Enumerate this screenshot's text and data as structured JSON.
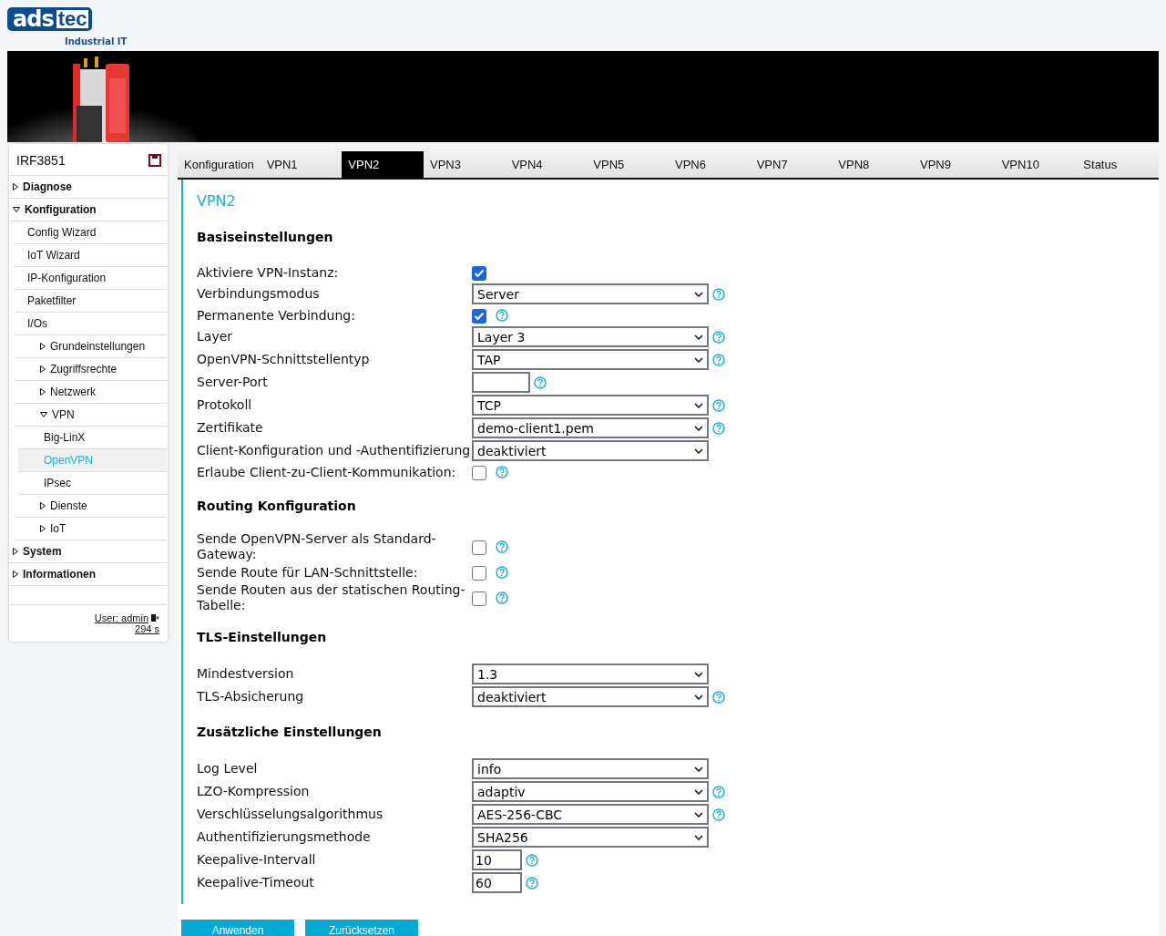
{
  "logo": {
    "part1": "ads",
    "part2": "tec",
    "tagline": "Industrial IT"
  },
  "banner": {
    "kind": "picture"
  },
  "sidebar": {
    "device": "IRF3851",
    "items": [
      {
        "label": "Diagnose",
        "expanded": false,
        "selected": false
      },
      {
        "label": "Konfiguration",
        "expanded": true,
        "selected": false,
        "children": [
          {
            "label": "Config Wizard",
            "selected": false
          },
          {
            "label": "IoT Wizard",
            "selected": false
          },
          {
            "label": "IP-Konfiguration",
            "selected": false
          },
          {
            "label": "Paketfilter",
            "selected": false
          },
          {
            "label": "I/Os",
            "selected": false
          },
          {
            "label": "Grundeinstellungen",
            "expanded": false,
            "selected": false
          },
          {
            "label": "Zugriffsrechte",
            "expanded": false,
            "selected": false
          },
          {
            "label": "Netzwerk",
            "expanded": false,
            "selected": false
          },
          {
            "label": "VPN",
            "expanded": true,
            "selected": false,
            "children": [
              {
                "label": "Big-LinX",
                "selected": false
              },
              {
                "label": "OpenVPN",
                "selected": true
              },
              {
                "label": "IPsec",
                "selected": false
              }
            ]
          },
          {
            "label": "Dienste",
            "expanded": false,
            "selected": false
          },
          {
            "label": "IoT",
            "expanded": false,
            "selected": false
          }
        ]
      },
      {
        "label": "System",
        "expanded": false,
        "selected": false
      },
      {
        "label": "Informationen",
        "expanded": false,
        "selected": false
      }
    ],
    "user": "User: admin",
    "timer": "294 s"
  },
  "tabs": [
    {
      "label": "Konfiguration",
      "selected": false
    },
    {
      "label": "VPN1",
      "selected": false
    },
    {
      "label": "VPN2",
      "selected": true
    },
    {
      "label": "VPN3",
      "selected": false
    },
    {
      "label": "VPN4",
      "selected": false
    },
    {
      "label": "VPN5",
      "selected": false
    },
    {
      "label": "VPN6",
      "selected": false
    },
    {
      "label": "VPN7",
      "selected": false
    },
    {
      "label": "VPN8",
      "selected": false
    },
    {
      "label": "VPN9",
      "selected": false
    },
    {
      "label": "VPN10",
      "selected": false
    },
    {
      "label": "Status",
      "selected": false
    }
  ],
  "title": "VPN2",
  "sections": [
    {
      "heading": "Basiseinstellungen",
      "fields": [
        {
          "kind": "checkbox",
          "label": "Aktiviere VPN-Instanz:",
          "checked": true,
          "help": false
        },
        {
          "kind": "select",
          "label": "Verbindungsmodus",
          "value": "Server",
          "help": true
        },
        {
          "kind": "checkbox",
          "label": "Permanente Verbindung:",
          "checked": true,
          "help": true
        },
        {
          "kind": "select",
          "label": "Layer",
          "value": "Layer 3",
          "help": true
        },
        {
          "kind": "select",
          "label": "OpenVPN-Schnittstellentyp",
          "value": "TAP",
          "help": true
        },
        {
          "kind": "input",
          "label": "Server-Port",
          "help": true
        },
        {
          "kind": "select",
          "label": "Protokoll",
          "value": "TCP",
          "help": true
        },
        {
          "kind": "select",
          "label": "Zertifikate",
          "value": "demo-client1.pem",
          "help": true
        },
        {
          "kind": "select",
          "label": "Client-Konfiguration und -Authentifizierung",
          "value": "deaktiviert",
          "help": false
        },
        {
          "kind": "checkbox",
          "label": "Erlaube Client-zu-Client-Kommunikation:",
          "checked": false,
          "help": true
        }
      ]
    },
    {
      "heading": "Routing Konfiguration",
      "fields": [
        {
          "kind": "checkbox",
          "label": "Sende OpenVPN-Server als Standard-Gateway:",
          "checked": false,
          "help": true
        },
        {
          "kind": "checkbox",
          "label": "Sende Route für LAN-Schnittstelle:",
          "checked": false,
          "help": true
        },
        {
          "kind": "checkbox",
          "label": "Sende Routen aus der statischen Routing-Tabelle:",
          "checked": false,
          "help": true
        }
      ]
    },
    {
      "heading": "TLS-Einstellungen",
      "fields": [
        {
          "kind": "select",
          "label": "Mindestversion",
          "value": "1.3",
          "help": false
        },
        {
          "kind": "select",
          "label": "TLS-Absicherung",
          "value": "deaktiviert",
          "help": true
        }
      ]
    },
    {
      "heading": "Zusätzliche Einstellungen",
      "fields": [
        {
          "kind": "select",
          "label": "Log Level",
          "value": "info",
          "help": false
        },
        {
          "kind": "select",
          "label": "LZO-Kompression",
          "value": "adaptiv",
          "help": true
        },
        {
          "kind": "select",
          "label": "Verschlüsselungsalgorithmus",
          "value": "AES-256-CBC",
          "help": true
        },
        {
          "kind": "select",
          "label": "Authentifizierungsmethode",
          "value": "SHA256",
          "help": false
        },
        {
          "kind": "input",
          "label": "Keepalive-Intervall",
          "value": "10",
          "help": true
        },
        {
          "kind": "input",
          "label": "Keepalive-Timeout",
          "value": "60",
          "help": true
        }
      ]
    }
  ],
  "buttons": [
    "Anwenden",
    "Zurücksetzen"
  ]
}
